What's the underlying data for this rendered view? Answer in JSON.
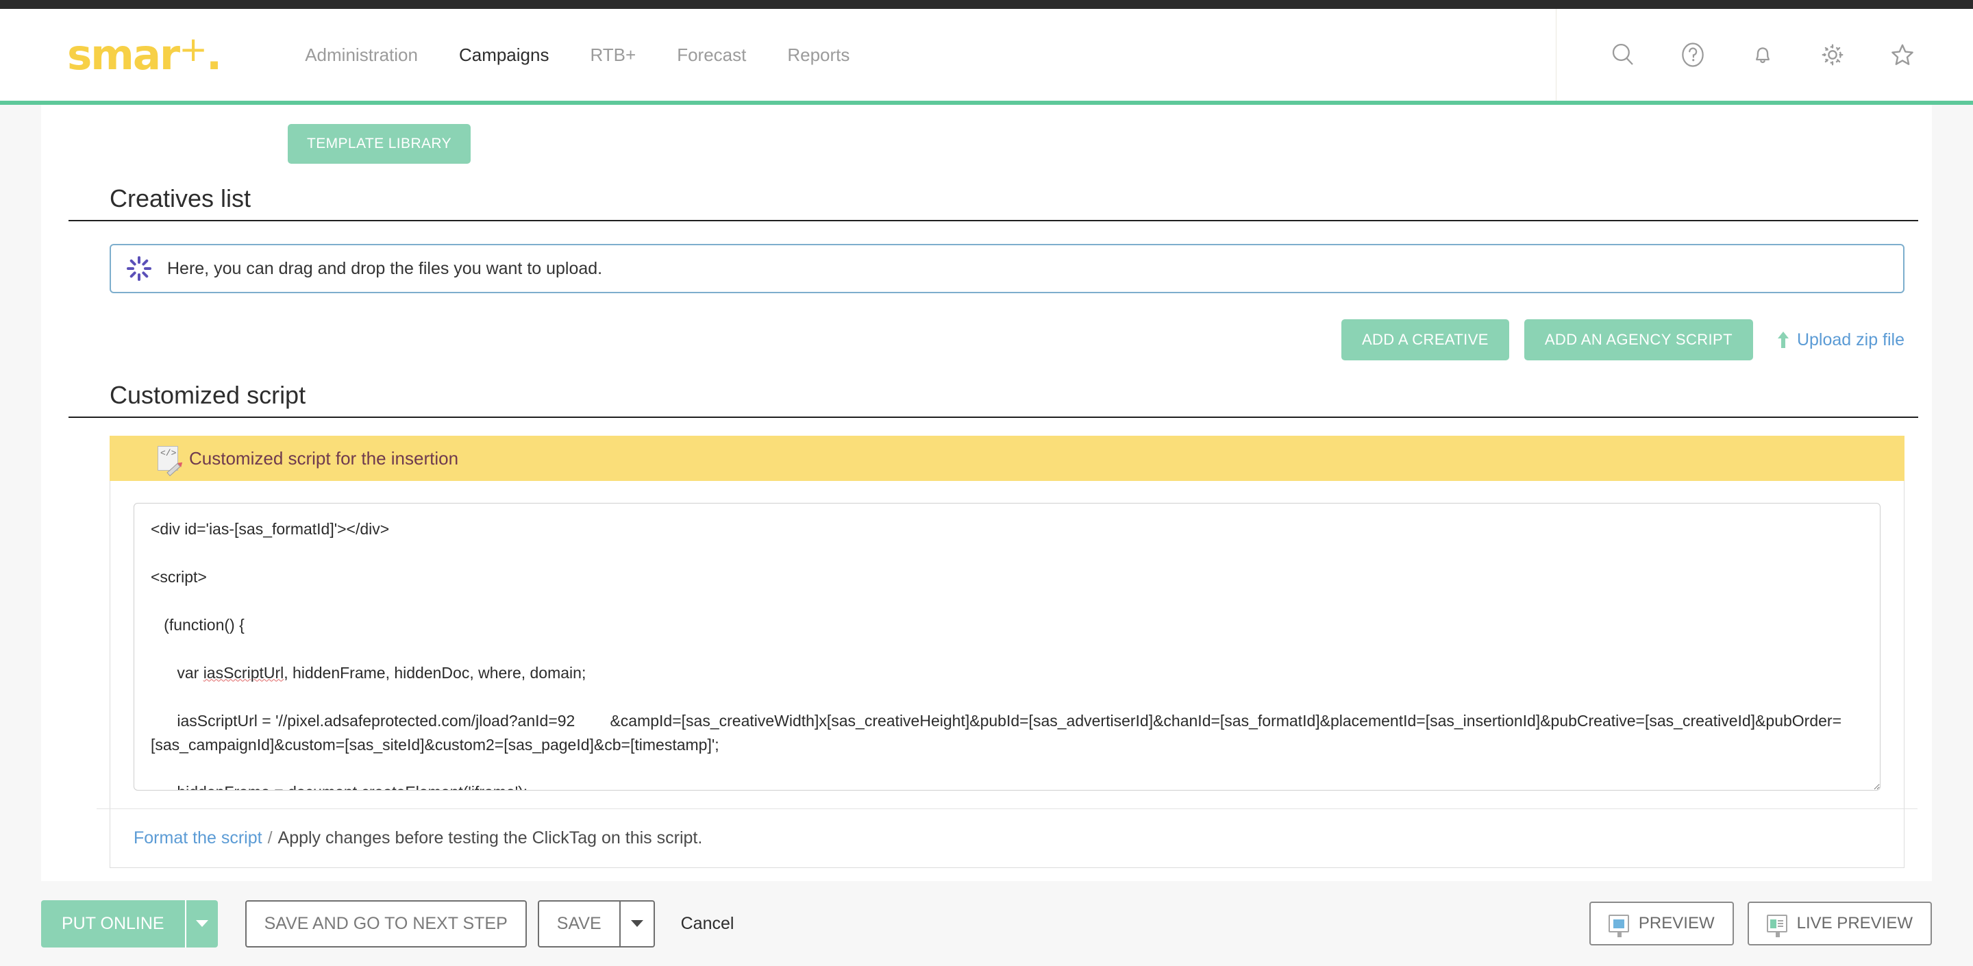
{
  "header": {
    "logo_text": "smar",
    "logo_plus": "+",
    "logo_dot": ".",
    "nav": [
      {
        "label": "Administration",
        "active": false
      },
      {
        "label": "Campaigns",
        "active": true
      },
      {
        "label": "RTB+",
        "active": false
      },
      {
        "label": "Forecast",
        "active": false
      },
      {
        "label": "Reports",
        "active": false
      }
    ],
    "icons": [
      {
        "name": "search-icon",
        "glyph": "search"
      },
      {
        "name": "help-icon",
        "glyph": "question"
      },
      {
        "name": "notifications-icon",
        "glyph": "bell"
      },
      {
        "name": "settings-icon",
        "glyph": "gear"
      },
      {
        "name": "favorites-icon",
        "glyph": "star"
      }
    ]
  },
  "toolbar": {
    "template_library_label": "TEMPLATE LIBRARY"
  },
  "creatives": {
    "section_title": "Creatives list",
    "dropzone_text": "Here, you can drag and drop the files you want to upload.",
    "dropzone_icon": "loading-spinner-icon",
    "add_creative_label": "ADD A CREATIVE",
    "add_agency_script_label": "ADD AN AGENCY SCRIPT",
    "upload_zip_label": "Upload zip file"
  },
  "customized_script": {
    "section_title": "Customized script",
    "banner_text": "Customized script for the insertion",
    "banner_icon": "edit-code-document-icon",
    "code_lines": [
      "<div id='ias-[sas_formatId]'></div>",
      "",
      "<script>",
      "",
      "   (function() {",
      "",
      "      var iasScriptUrl, hiddenFrame, hiddenDoc, where, domain;",
      "",
      "      iasScriptUrl = '//pixel.adsafeprotected.com/jload?anId=92        &campId=[sas_creativeWidth]x[sas_creativeHeight]&pubId=[sas_advertiserId]&chanId=[sas_formatId]&placementId=[sas_insertionId]&pubCreative=[sas_creativeId]&pubOrder=[sas_campaignId]&custom=[sas_siteId]&custom2=[sas_pageId]&cb=[timestamp]';",
      "",
      "      hiddenFrame = document.createElement('iframe');"
    ],
    "misspelled_token": "iasScriptUrl",
    "format_script_link": "Format the script",
    "separator": "/",
    "footer_note": "Apply changes before testing the ClickTag on this script."
  },
  "bottom_bar": {
    "put_online_label": "PUT ONLINE",
    "save_next_label": "SAVE AND GO TO NEXT STEP",
    "save_label": "SAVE",
    "cancel_label": "Cancel",
    "preview_label": "PREVIEW",
    "live_preview_label": "LIVE PREVIEW"
  },
  "colors": {
    "brand_yellow": "#f7d046",
    "accent_green": "#8bd3b4",
    "header_rule_green": "#5ec89a",
    "banner_yellow": "#fade79",
    "link_blue": "#5b9bd5",
    "dropzone_blue": "#7daecd"
  }
}
